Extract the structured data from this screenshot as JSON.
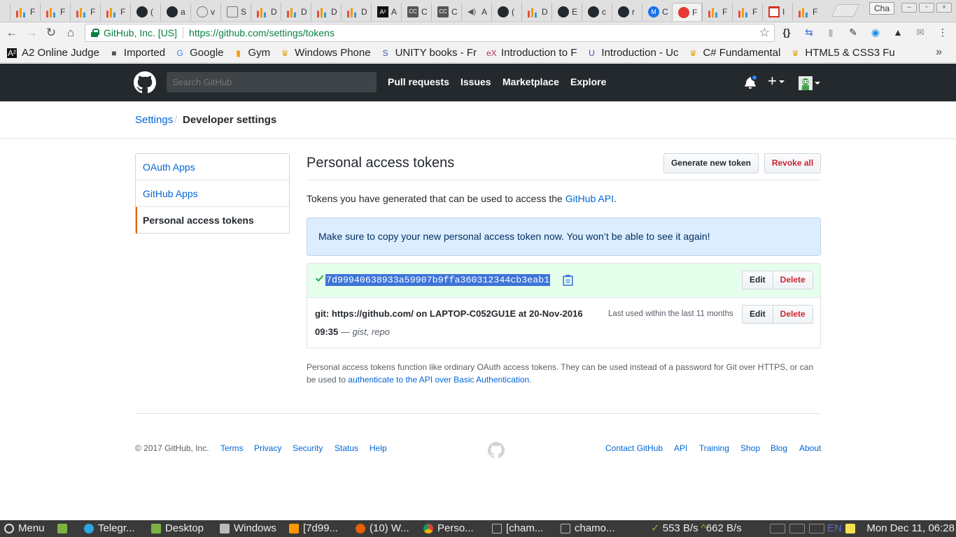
{
  "browser": {
    "tabs": [
      {
        "icon": "chart-icon",
        "label": "F"
      },
      {
        "icon": "chart-icon",
        "label": "F"
      },
      {
        "icon": "chart-icon",
        "label": "F"
      },
      {
        "icon": "chart-icon",
        "label": "F"
      },
      {
        "icon": "github-icon",
        "label": "("
      },
      {
        "icon": "github-icon",
        "label": "a"
      },
      {
        "icon": "circle-icon",
        "label": "v"
      },
      {
        "icon": "page-icon",
        "label": "S"
      },
      {
        "icon": "chart-icon",
        "label": "D"
      },
      {
        "icon": "chart-icon",
        "label": "D"
      },
      {
        "icon": "chart-icon",
        "label": "D"
      },
      {
        "icon": "chart-icon",
        "label": "D"
      },
      {
        "icon": "a2-icon",
        "label": "A"
      },
      {
        "icon": "cc-icon",
        "label": "C"
      },
      {
        "icon": "cc-icon",
        "label": "C"
      },
      {
        "icon": "speaker-icon",
        "label": "A"
      },
      {
        "icon": "github-icon",
        "label": "("
      },
      {
        "icon": "chart-icon",
        "label": "D"
      },
      {
        "icon": "github-icon",
        "label": "E"
      },
      {
        "icon": "github-icon",
        "label": "c"
      },
      {
        "icon": "github-icon",
        "label": "r"
      },
      {
        "icon": "m-icon",
        "label": "C"
      },
      {
        "icon": "close-red-icon",
        "label": "F",
        "active": true
      },
      {
        "icon": "chart-icon",
        "label": "F"
      },
      {
        "icon": "chart-icon",
        "label": "F"
      },
      {
        "icon": "gmail-icon",
        "label": "I"
      },
      {
        "icon": "chart-icon",
        "label": "F"
      }
    ],
    "profile_label": "Cha",
    "address": {
      "ev_label": "GitHub, Inc. [US]",
      "url": "https://github.com/settings/tokens"
    },
    "bookmarks": [
      {
        "icon": "a2-icon",
        "label": "A2 Online Judge"
      },
      {
        "icon": "folder-icon",
        "label": "Imported"
      },
      {
        "icon": "google-icon",
        "label": "Google"
      },
      {
        "icon": "chart-icon",
        "label": "Gym"
      },
      {
        "icon": "crown-icon",
        "label": "Windows Phone"
      },
      {
        "icon": "s-icon",
        "label": "UNITY books - Fr"
      },
      {
        "icon": "edx-icon",
        "label": "Introduction to F"
      },
      {
        "icon": "udemy-icon",
        "label": "Introduction - Uc"
      },
      {
        "icon": "crown-icon",
        "label": "C# Fundamental"
      },
      {
        "icon": "crown-icon",
        "label": "HTML5 & CSS3 Fu"
      }
    ],
    "bookmarks_more": "»"
  },
  "gh": {
    "search_placeholder": "Search GitHub",
    "nav": [
      "Pull requests",
      "Issues",
      "Marketplace",
      "Explore"
    ],
    "plus": "+"
  },
  "breadcrumb": {
    "settings": "Settings",
    "separator": "/",
    "current": "Developer settings"
  },
  "side_menu": {
    "items": [
      "OAuth Apps",
      "GitHub Apps",
      "Personal access tokens"
    ],
    "selected_index": 2
  },
  "main": {
    "title": "Personal access tokens",
    "generate_button": "Generate new token",
    "revoke_button": "Revoke all",
    "intro_text": "Tokens you have generated that can be used to access the ",
    "intro_link": "GitHub API",
    "intro_suffix": ".",
    "flash": "Make sure to copy your new personal access token now. You won’t be able to see it again!",
    "tokens": [
      {
        "value": "7d99940638933a59907b9ffa360312344cb3eab1",
        "edit": "Edit",
        "delete": "Delete"
      },
      {
        "description": "git: https://github.com/ on LAPTOP-C052GU1E at 20-Nov-2016 09:35",
        "dash": "—",
        "scopes": "gist, repo",
        "last_used": "Last used within the last 11 months",
        "edit": "Edit",
        "delete": "Delete"
      }
    ],
    "help_text": "Personal access tokens function like ordinary OAuth access tokens. They can be used instead of a password for Git over HTTPS, or can be used to ",
    "help_link": "authenticate to the API over Basic Authentication",
    "help_suffix": "."
  },
  "footer": {
    "copyright": "© 2017 GitHub, Inc.",
    "left_links": [
      "Terms",
      "Privacy",
      "Security",
      "Status",
      "Help"
    ],
    "right_links": [
      "Contact GitHub",
      "API",
      "Training",
      "Shop",
      "Blog",
      "About"
    ]
  },
  "taskbar": {
    "menu": "Menu",
    "items": [
      "Telegr...",
      "Desktop",
      "Windows",
      "[7d99...",
      "(10) W...",
      "Perso...",
      "[cham...",
      "chamo..."
    ],
    "net_down": "553 B/s",
    "net_up": "662 B/s",
    "lang": "EN",
    "clock": "Mon Dec 11, 06:28"
  },
  "colors": {
    "gh_header": "#24292e",
    "link": "#0366d6",
    "danger": "#cb2431",
    "flash_bg": "#dbedff",
    "new_token_bg": "#e6ffed",
    "ev_green": "#0b8043"
  }
}
